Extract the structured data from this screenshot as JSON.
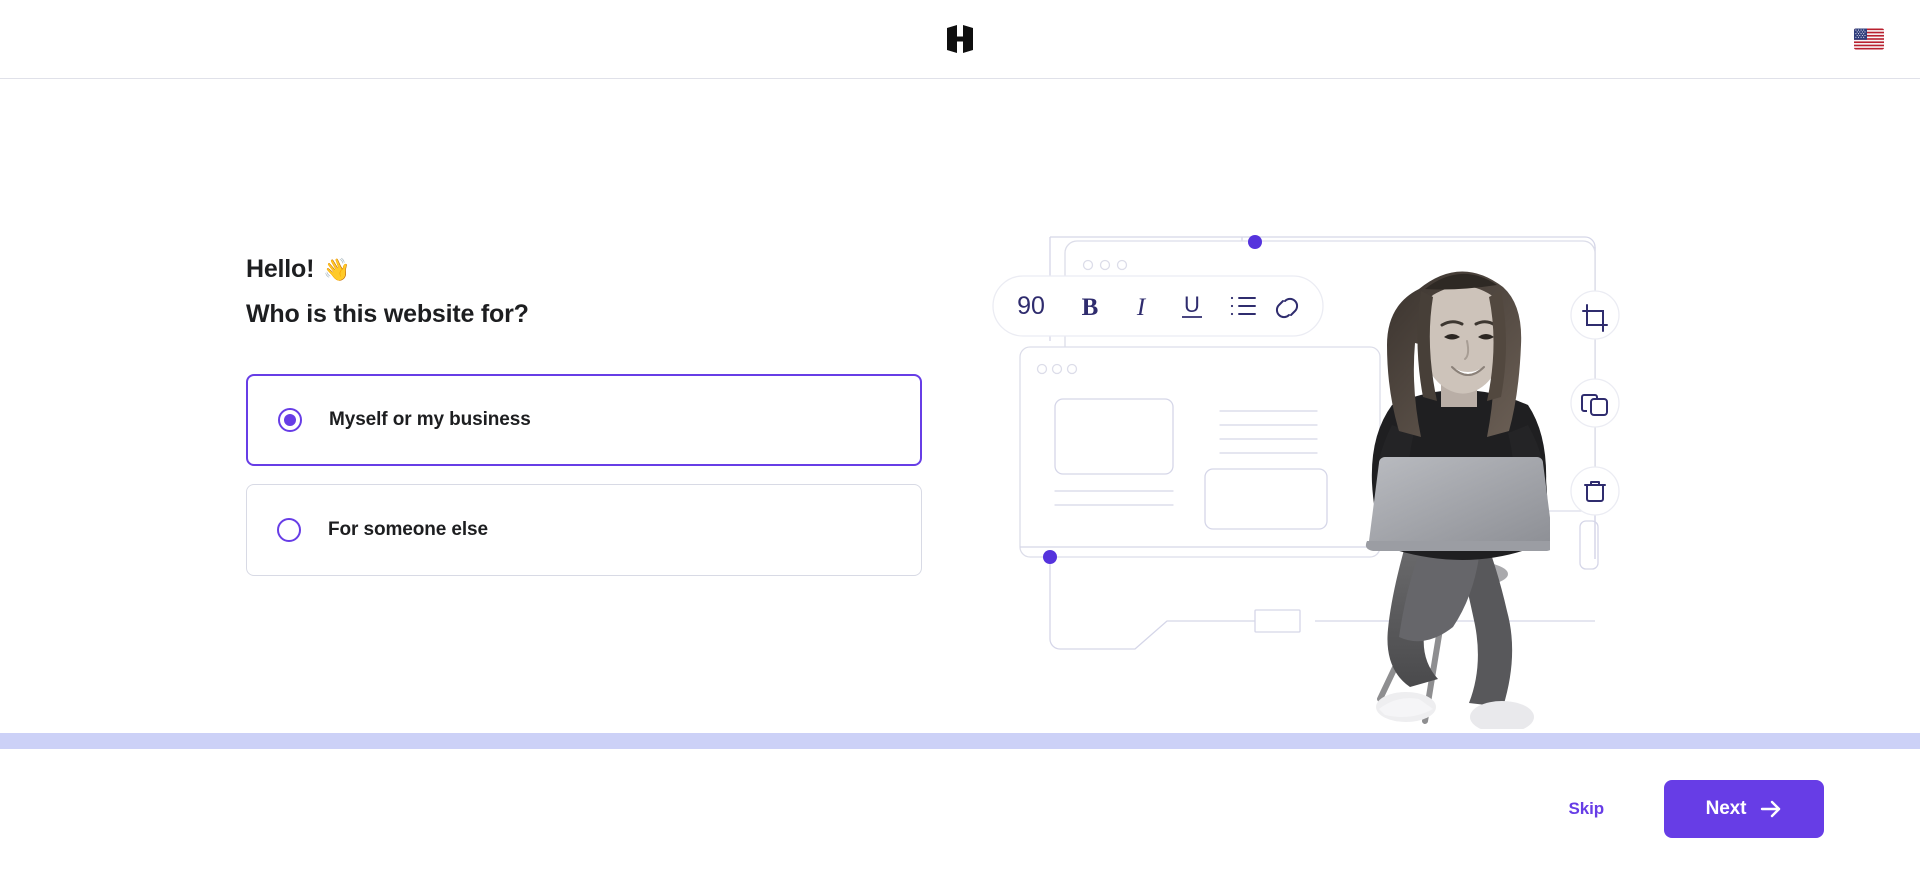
{
  "header": {
    "logo_name": "hostinger-logo",
    "language_flag": "us-flag",
    "language_code": "US"
  },
  "main": {
    "greeting": "Hello!",
    "greeting_emoji": "👋",
    "question": "Who is this website for?",
    "options": [
      {
        "label": "Myself or my business",
        "selected": true
      },
      {
        "label": "For someone else",
        "selected": false
      }
    ]
  },
  "illustration": {
    "toolbar": {
      "size_value": "90",
      "bold_label": "B",
      "italic_label": "I",
      "underline_label": "U",
      "list_icon": "bullet-list-icon",
      "link_icon": "link-icon"
    },
    "side_tools": [
      "crop-icon",
      "duplicate-icon",
      "trash-icon"
    ],
    "photo_alt": "woman-with-laptop-photo"
  },
  "footer": {
    "skip_label": "Skip",
    "next_label": "Next",
    "next_icon": "arrow-right-icon",
    "progress_percent": 100
  },
  "colors": {
    "accent": "#673de6",
    "progress_track": "#ccd1f7",
    "text": "#1d1e20",
    "border": "#d8dae5",
    "icon_navy": "#2f2c6e"
  }
}
